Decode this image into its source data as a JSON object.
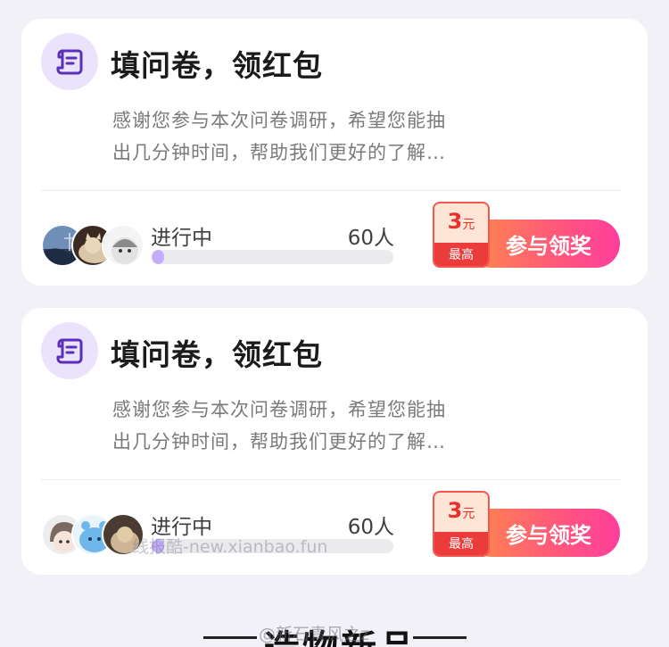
{
  "colors": {
    "page_background": "#f2f1f8",
    "card_background": "#ffffff",
    "icon_background": "#ebe3fb",
    "icon_accent": "#5b2fb8",
    "progress_fill": "#c4aefc",
    "button_gradient_start": "#ff8a4c",
    "button_gradient_end": "#ff3e9c",
    "badge_red": "#ec3b3b"
  },
  "surveys": [
    {
      "icon": "scroll-survey-icon",
      "title": "填问卷，领红包",
      "description": "感谢您参与本次问卷调研，希望您能抽出几分钟时间，帮助我们更好的了解…",
      "avatars": [
        "landscape-avatar",
        "cat-avatar",
        "cartoon-avatar"
      ],
      "status": "进行中",
      "participants": "60人",
      "progress": 0.03,
      "reward_amount": "3",
      "reward_unit": "元",
      "reward_label": "最高",
      "button_label": "参与领奖"
    },
    {
      "icon": "scroll-survey-icon",
      "title": "填问卷，领红包",
      "description": "感谢您参与本次问卷调研，希望您能抽出几分钟时间，帮助我们更好的了解…",
      "avatars": [
        "cartoon-girl-avatar",
        "blue-character-avatar",
        "cat-photo-avatar"
      ],
      "status": "进行中",
      "participants": "60人",
      "progress": 0.03,
      "reward_amount": "3",
      "reward_unit": "元",
      "reward_label": "最高",
      "button_label": "参与领奖"
    }
  ],
  "watermark": "线报酷-new.xianbao.fun",
  "section": {
    "title": "造物新品",
    "overlay_mark": "@新石青风之z"
  }
}
